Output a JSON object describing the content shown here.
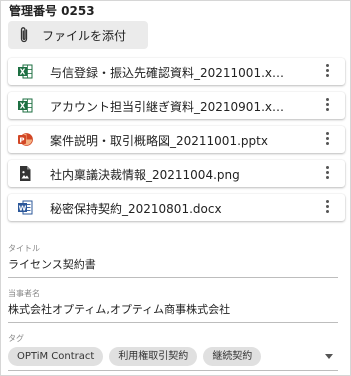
{
  "header": {
    "management_number": "管理番号 0253"
  },
  "attach_button": {
    "label": "ファイルを添付",
    "icon": "paperclip-icon"
  },
  "files": [
    {
      "name": "与信登録・振込先確認資料_20211001.x…",
      "type": "excel",
      "icon": "excel-icon",
      "color": "#1d6f42"
    },
    {
      "name": "アカウント担当引継ぎ資料_20210901.x…",
      "type": "excel",
      "icon": "excel-icon",
      "color": "#1d6f42"
    },
    {
      "name": "案件説明・取引概略図_20211001.pptx",
      "type": "powerpoint",
      "icon": "powerpoint-icon",
      "color": "#d24726"
    },
    {
      "name": "社内稟議決裁情報_20211004.png",
      "type": "image",
      "icon": "image-file-icon",
      "color": "#333333"
    },
    {
      "name": "秘密保持契約_20210801.docx",
      "type": "word",
      "icon": "word-icon",
      "color": "#2b579a"
    }
  ],
  "fields": {
    "title": {
      "label": "タイトル",
      "value": "ライセンス契約書"
    },
    "parties": {
      "label": "当事者名",
      "value": "株式会社オプティム,オプティム商事株式会社"
    },
    "tags": {
      "label": "タグ",
      "items": [
        "OPTiM Contract",
        "利用権取引契約",
        "継続契約"
      ]
    }
  }
}
